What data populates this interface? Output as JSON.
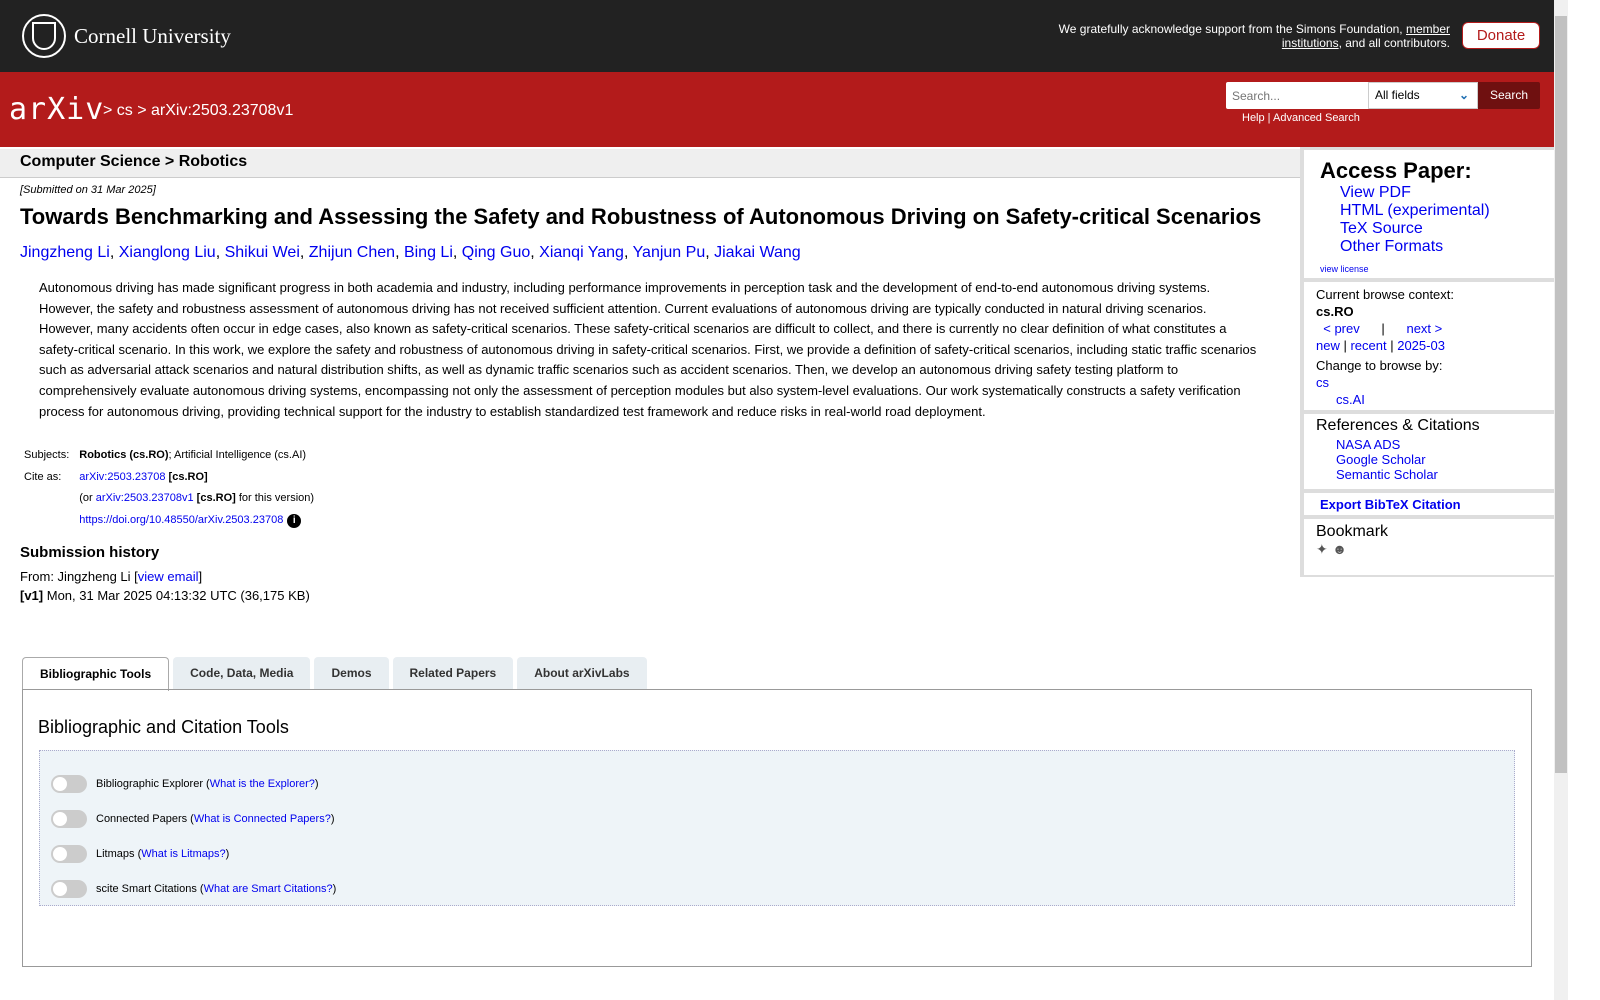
{
  "header": {
    "university": "Cornell University",
    "ack_text": "We gratefully acknowledge support from the Simons Foundation,",
    "ack_link": "member institutions",
    "ack_end": ", and all contributors.",
    "donate": "Donate"
  },
  "nav": {
    "logo": "arXiv",
    "breadcrumb": "> cs > arXiv:2503.23708v1",
    "search_placeholder": "Search...",
    "field": "All fields",
    "search_button": "Search",
    "help": "Help",
    "advanced": "Advanced Search"
  },
  "category": "Computer Science > Robotics",
  "paper": {
    "submitted": "[Submitted on 31 Mar 2025]",
    "title": "Towards Benchmarking and Assessing the Safety and Robustness of Autonomous Driving on Safety-critical Scenarios",
    "authors": [
      "Jingzheng Li",
      "Xianglong Liu",
      "Shikui Wei",
      "Zhijun Chen",
      "Bing Li",
      "Qing Guo",
      "Xianqi Yang",
      "Yanjun Pu",
      "Jiakai Wang"
    ],
    "abstract": "Autonomous driving has made significant progress in both academia and industry, including performance improvements in perception task and the development of end-to-end autonomous driving systems. However, the safety and robustness assessment of autonomous driving has not received sufficient attention. Current evaluations of autonomous driving are typically conducted in natural driving scenarios. However, many accidents often occur in edge cases, also known as safety-critical scenarios. These safety-critical scenarios are difficult to collect, and there is currently no clear definition of what constitutes a safety-critical scenario. In this work, we explore the safety and robustness of autonomous driving in safety-critical scenarios. First, we provide a definition of safety-critical scenarios, including static traffic scenarios such as adversarial attack scenarios and natural distribution shifts, as well as dynamic traffic scenarios such as accident scenarios. Then, we develop an autonomous driving safety testing platform to comprehensively evaluate autonomous driving systems, encompassing not only the assessment of perception modules but also system-level evaluations. Our work systematically constructs a safety verification process for autonomous driving, providing technical support for the industry to establish standardized test framework and reduce risks in real-world road deployment.",
    "subjects_label": "Subjects:",
    "subject_primary": "Robotics (cs.RO)",
    "subject_rest": "; Artificial Intelligence (cs.AI)",
    "cite_label": "Cite as:",
    "cite_id": "arXiv:2503.23708",
    "cite_cat": "[cs.RO]",
    "or": "(or ",
    "cite_v": "arXiv:2503.23708v1",
    "cite_v_cat": "[cs.RO]",
    "for_version": " for this version)",
    "doi": "https://doi.org/10.48550/arXiv.2503.23708",
    "history_title": "Submission history",
    "from": "From: Jingzheng Li [",
    "view_email": "view email",
    "from_end": "]",
    "v1": "[v1]",
    "v1_text": " Mon, 31 Mar 2025 04:13:32 UTC (36,175 KB)"
  },
  "sidebar": {
    "access_title": "Access Paper:",
    "access": [
      "View PDF",
      "HTML (experimental)",
      "TeX Source",
      "Other Formats"
    ],
    "license": "view license",
    "context_label": "Current browse context:",
    "context": "cs.RO",
    "prev": "< prev",
    "sep": "|",
    "next": "next >",
    "new": "new",
    "recent": "recent",
    "month": "2025-03",
    "change_label": "Change to browse by:",
    "browse": [
      "cs",
      "cs.AI"
    ],
    "refs_title": "References & Citations",
    "refs": [
      "NASA ADS",
      "Google Scholar",
      "Semantic Scholar"
    ],
    "bibtex": "Export BibTeX Citation",
    "bookmark": "Bookmark"
  },
  "tabs": [
    "Bibliographic Tools",
    "Code, Data, Media",
    "Demos",
    "Related Papers",
    "About arXivLabs"
  ],
  "tools": {
    "title": "Bibliographic and Citation Tools",
    "items": [
      {
        "name": "Bibliographic Explorer",
        "link": "What is the Explorer?"
      },
      {
        "name": "Connected Papers",
        "link": "What is Connected Papers?"
      },
      {
        "name": "Litmaps",
        "link": "What is Litmaps?"
      },
      {
        "name": "scite Smart Citations",
        "link": "What are Smart Citations?"
      }
    ]
  }
}
